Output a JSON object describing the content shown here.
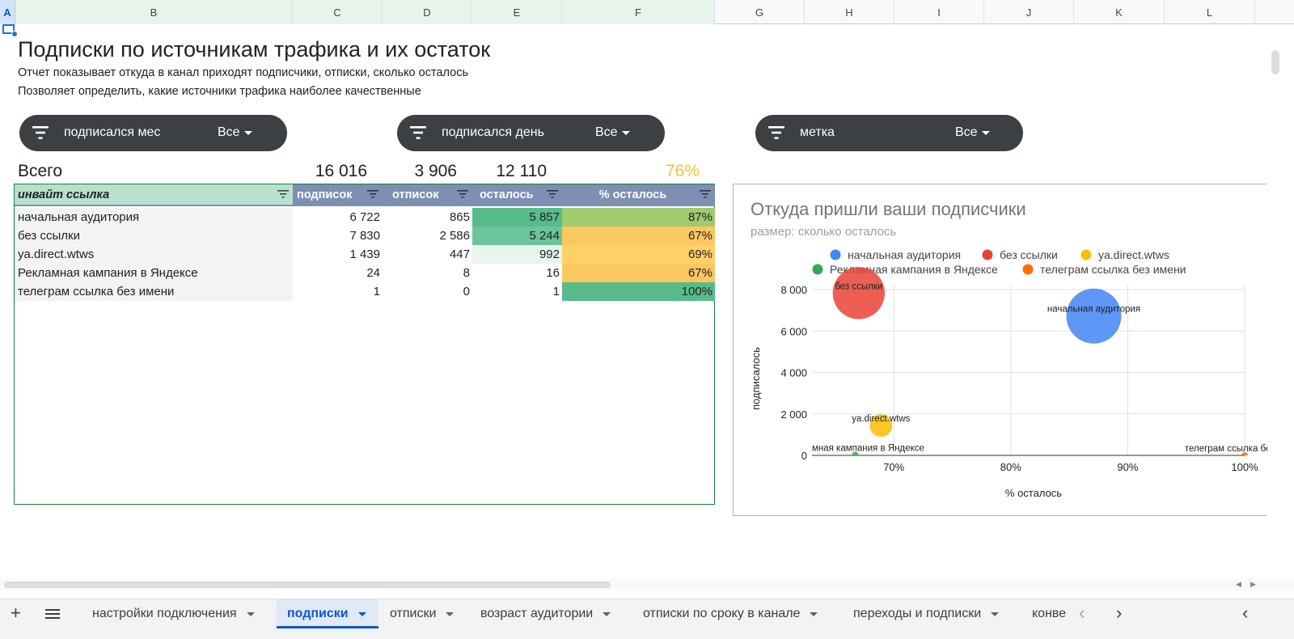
{
  "columns": [
    "A",
    "B",
    "C",
    "D",
    "E",
    "F",
    "G",
    "H",
    "I",
    "J",
    "K",
    "L"
  ],
  "title": "Подписки по источникам трафика и их остаток",
  "description": [
    "Отчет показывает откуда в канал приходят подписчики, отписки, сколько осталось",
    "Позволяет определить, какие источники трафика наиболее качественные"
  ],
  "filters": [
    {
      "label": "подписался мес",
      "value": "Все"
    },
    {
      "label": "подписался день",
      "value": "Все"
    },
    {
      "label": "метка",
      "value": "Все"
    }
  ],
  "totals": {
    "label": "Всего",
    "subscribed": "16 016",
    "unsubscribed": "3 906",
    "remaining": "12 110",
    "percent": "76%"
  },
  "pivot": {
    "headers": [
      "инвайт ссылка",
      "подписок",
      "отписок",
      "осталось",
      "% осталось"
    ],
    "rows": [
      {
        "name": "начальная аудитория",
        "subs": "6 722",
        "unsubs": "865",
        "left": "5 857",
        "pct": "87%"
      },
      {
        "name": "без ссылки",
        "subs": "7 830",
        "unsubs": "2 586",
        "left": "5 244",
        "pct": "67%"
      },
      {
        "name": "ya.direct.wtws",
        "subs": "1 439",
        "unsubs": "447",
        "left": "992",
        "pct": "69%"
      },
      {
        "name": "Рекламная кампания в Яндексе",
        "subs": "24",
        "unsubs": "8",
        "left": "16",
        "pct": "67%"
      },
      {
        "name": "телеграм ссылка без имени",
        "subs": "1",
        "unsubs": "0",
        "left": "1",
        "pct": "100%"
      }
    ]
  },
  "chart_data": {
    "type": "scatter",
    "title": "Откуда пришли ваши подписчики",
    "subtitle": "размер: сколько осталось",
    "xlabel": "% осталось",
    "ylabel": "подписалось",
    "xlim": [
      0.63,
      1.0
    ],
    "ylim": [
      0,
      8000
    ],
    "xticks": [
      "70%",
      "80%",
      "90%",
      "100%"
    ],
    "yticks": [
      "0",
      "2 000",
      "4 000",
      "6 000",
      "8 000"
    ],
    "legend_position": "top",
    "grid": true,
    "series": [
      {
        "name": "начальная аудитория",
        "x": 0.871,
        "y": 6722,
        "size": 5857,
        "color": "#4285f4"
      },
      {
        "name": "без ссылки",
        "x": 0.67,
        "y": 7830,
        "size": 5244,
        "color": "#ea4335"
      },
      {
        "name": "ya.direct.wtws",
        "x": 0.689,
        "y": 1439,
        "size": 992,
        "color": "#fbbc04"
      },
      {
        "name": "Рекламная кампания в Яндексе",
        "x": 0.667,
        "y": 24,
        "size": 16,
        "color": "#34a853"
      },
      {
        "name": "телеграм ссылка без имени",
        "x": 1.0,
        "y": 1,
        "size": 1,
        "color": "#ff6d01"
      }
    ]
  },
  "tabs": [
    {
      "label": "настройки подключения",
      "active": false,
      "color": "#f4a7a0"
    },
    {
      "label": "подписки",
      "active": true,
      "color": "#0b57d0"
    },
    {
      "label": "отписки",
      "active": false,
      "color": "#f6b26b"
    },
    {
      "label": "возраст аудитории",
      "active": false,
      "color": "#ffd966"
    },
    {
      "label": "отписки по сроку в канале",
      "active": false,
      "color": "#93c47d"
    },
    {
      "label": "переходы и подписки",
      "active": false,
      "color": "#8e7cc3"
    },
    {
      "label": "конве",
      "active": false,
      "color": ""
    }
  ]
}
